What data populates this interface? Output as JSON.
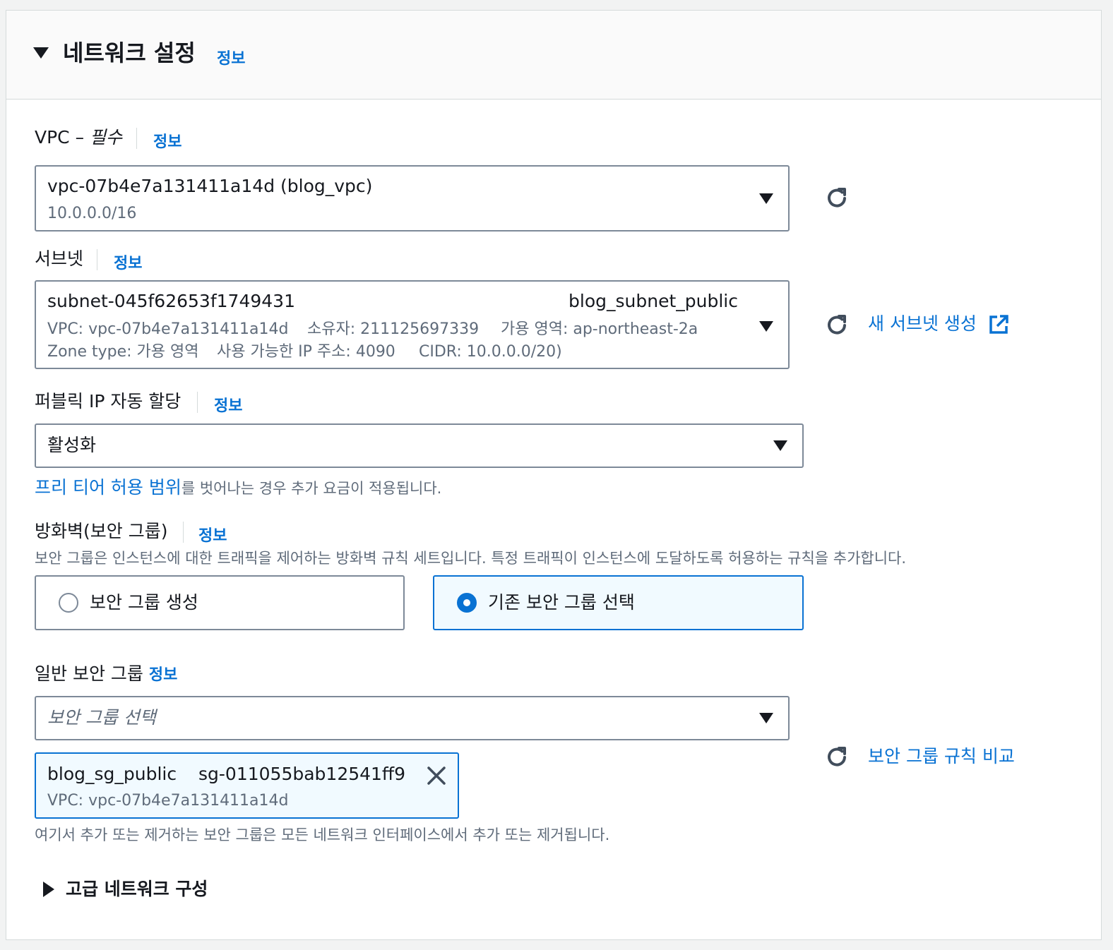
{
  "section": {
    "title": "네트워크 설정",
    "info": "정보"
  },
  "vpc": {
    "label": "VPC – ",
    "required": "필수",
    "info": "정보",
    "value": "vpc-07b4e7a131411a14d (blog_vpc)",
    "cidr": "10.0.0.0/16"
  },
  "subnet": {
    "label": "서브넷",
    "info": "정보",
    "id": "subnet-045f62653f1749431",
    "name": "blog_subnet_public",
    "line2_vpc": "VPC: vpc-07b4e7a131411a14d",
    "line2_owner": "소유자: 211125697339",
    "line2_az": "가용 영역: ap-northeast-2a",
    "line3_zone": "Zone type: 가용 영역",
    "line3_ips": "사용 가능한 IP 주소: 4090",
    "line3_cidr": "CIDR: 10.0.0.0/20)",
    "create_link": "새 서브넷 생성"
  },
  "public_ip": {
    "label": "퍼블릭 IP 자동 할당",
    "info": "정보",
    "value": "활성화",
    "note_link": "프리 티어 허용 범위",
    "note_text": "를 벗어나는 경우 추가 요금이 적용됩니다."
  },
  "firewall": {
    "label": "방화벽(보안 그룹)",
    "info": "정보",
    "description": "보안 그룹은 인스턴스에 대한 트래픽을 제어하는 방화벽 규칙 세트입니다. 특정 트래픽이 인스턴스에 도달하도록 허용하는 규칙을 추가합니다.",
    "option_create": "보안 그룹 생성",
    "option_existing": "기존 보안 그룹 선택",
    "selected": "기존 보안 그룹 선택"
  },
  "common_sg": {
    "label": "일반 보안 그룹",
    "info": "정보",
    "placeholder": "보안 그룹 선택",
    "token_name": "blog_sg_public",
    "token_id": "sg-011055bab12541ff9",
    "token_vpc": "VPC: vpc-07b4e7a131411a14d",
    "compare_link": "보안 그룹 규칙 비교",
    "note": "여기서 추가 또는 제거하는 보안 그룹은 모든 네트워크 인터페이스에서 추가 또는 제거됩니다."
  },
  "advanced": {
    "label": "고급 네트워크 구성"
  },
  "icons": {
    "collapse": "caret-down-icon",
    "expand": "caret-right-icon",
    "refresh": "refresh-icon",
    "external": "external-link-icon",
    "remove": "close-icon",
    "dropdown": "dropdown-caret-icon"
  },
  "colors": {
    "link": "#0972d3",
    "text": "#16191f",
    "muted": "#5f6b7a",
    "border": "#7d8998",
    "selected_bg": "#f1faff"
  }
}
